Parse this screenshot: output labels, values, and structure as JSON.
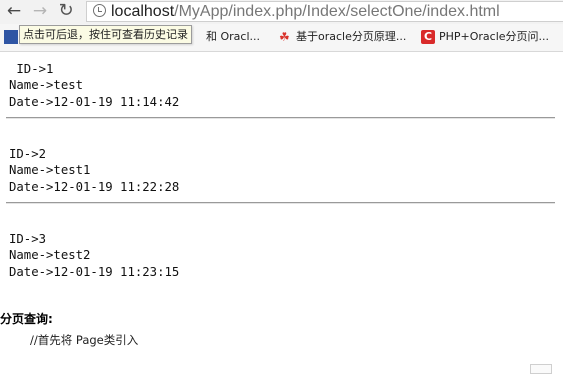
{
  "browser": {
    "url_host": "localhost",
    "url_path": "/MyApp/index.php/Index/selectOne/index.html",
    "tooltip": "点击可后退，按住可查看历史记录",
    "bookmarks": [
      {
        "label": "和 Oracl..."
      },
      {
        "label": "基于oracle分页原理..."
      },
      {
        "label": "PHP+Oracle分页问..."
      }
    ]
  },
  "records": [
    {
      "id_line": " ID->1",
      "name_line": "Name->test",
      "date_line": "Date->12-01-19 11:14:42"
    },
    {
      "id_line": "ID->2",
      "name_line": "Name->test1",
      "date_line": "Date->12-01-19 11:22:28"
    },
    {
      "id_line": "ID->3",
      "name_line": "Name->test2",
      "date_line": "Date->12-01-19 11:23:15"
    }
  ],
  "article": {
    "section_title": "分页查询:",
    "code_comment": "//首先将 Page类引入"
  }
}
